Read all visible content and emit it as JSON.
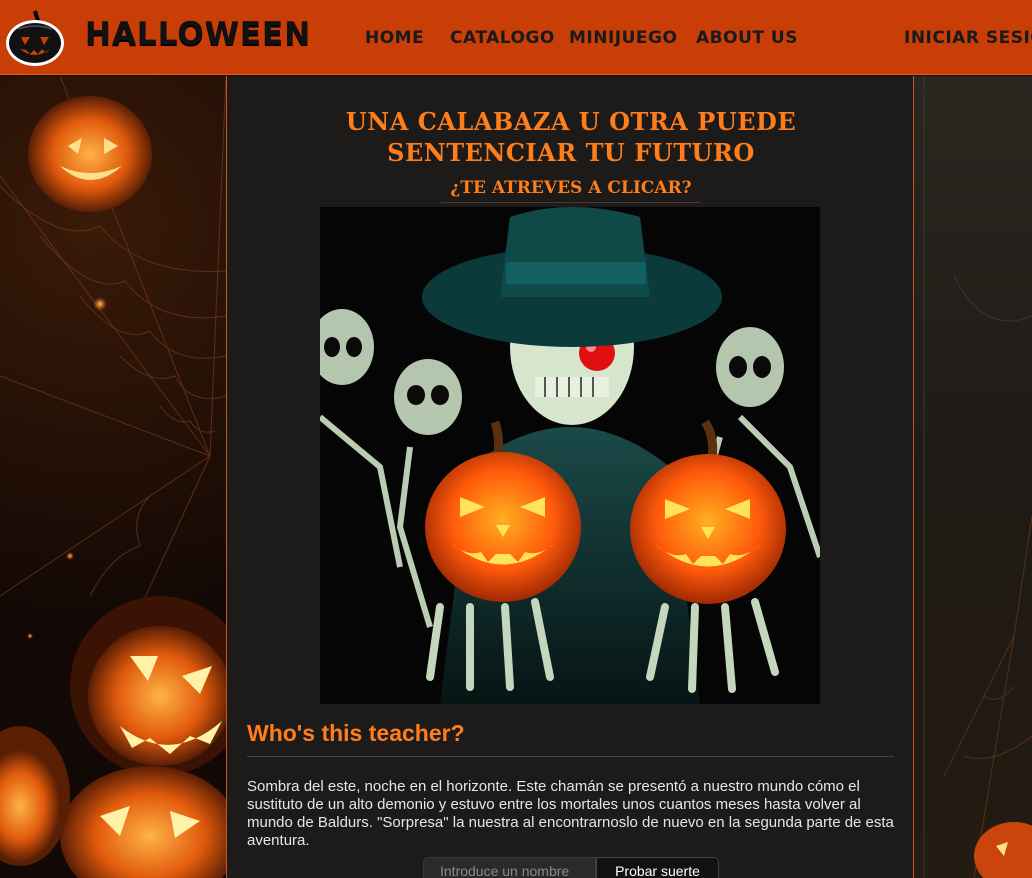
{
  "header": {
    "logo_text": "HALLOWEEN",
    "nav": [
      {
        "label": "HOME"
      },
      {
        "label": "CATALOGO"
      },
      {
        "label": "MINIJUEGO"
      },
      {
        "label": "ABOUT US"
      }
    ],
    "login_label": "INICIAR SESIO"
  },
  "main": {
    "title": "UNA CALABAZA U OTRA PUEDE SENTENCIAR TU FUTURO",
    "subtitle": "¿TE ATREVES A CLICAR?",
    "section_title": "Who's this teacher?",
    "description": "Sombra del este, noche en el horizonte. Este chamán se presentó a nuestro mundo cómo el sustituto de un alto demonio y estuvo entre los mortales unos cuantos meses hasta volver al mundo de Baldurs. \"Sorpresa\" la nuestra al encontrarnoslo de nuevo en la segunda parte de esta aventura.",
    "name_input": {
      "placeholder": "Introduce un nombre",
      "value": ""
    },
    "try_button": "Probar suerte"
  },
  "colors": {
    "header_bg": "#c93d06",
    "accent": "#ff7d1a",
    "panel_bg": "#1c1b1a"
  }
}
